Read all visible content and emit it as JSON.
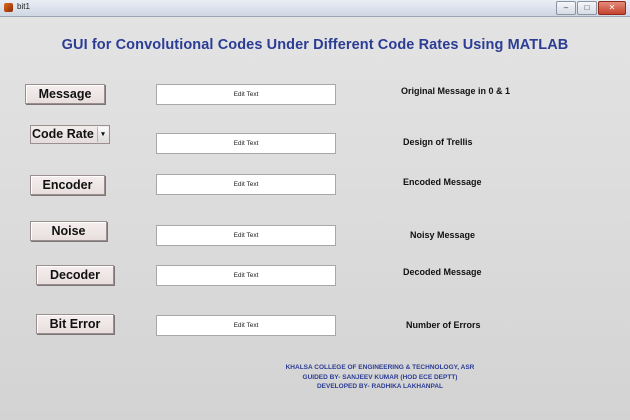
{
  "window": {
    "title": "bit1",
    "buttons": [
      "–",
      "□",
      "✕"
    ]
  },
  "heading": "GUI for Convolutional Codes Under Different Code Rates Using MATLAB",
  "rows": [
    {
      "button": "Message",
      "edit": "Edit Text",
      "label": "Original Message in 0 & 1"
    },
    {
      "button": "Code Rate",
      "edit": "Edit Text",
      "label": "Design of Trellis"
    },
    {
      "button": "Encoder",
      "edit": "Edit Text",
      "label": "Encoded Message"
    },
    {
      "button": "Noise",
      "edit": "Edit Text",
      "label": "Noisy Message"
    },
    {
      "button": "Decoder",
      "edit": "Edit Text",
      "label": "Decoded Message"
    },
    {
      "button": "Bit Error",
      "edit": "Edit Text",
      "label": "Number of Errors"
    }
  ],
  "popup_arrow": "▾",
  "footer": [
    "KHALSA COLLEGE OF ENGINEERING & TECHNOLOGY, ASR",
    "GUIDED  BY- SANJEEV KUMAR (HOD ECE DEPTT)",
    "DEVELOPED BY- RADHIKA LAKHANPAL"
  ],
  "colors": {
    "heading": "#2b3c94",
    "background": "#dcdcdc"
  }
}
